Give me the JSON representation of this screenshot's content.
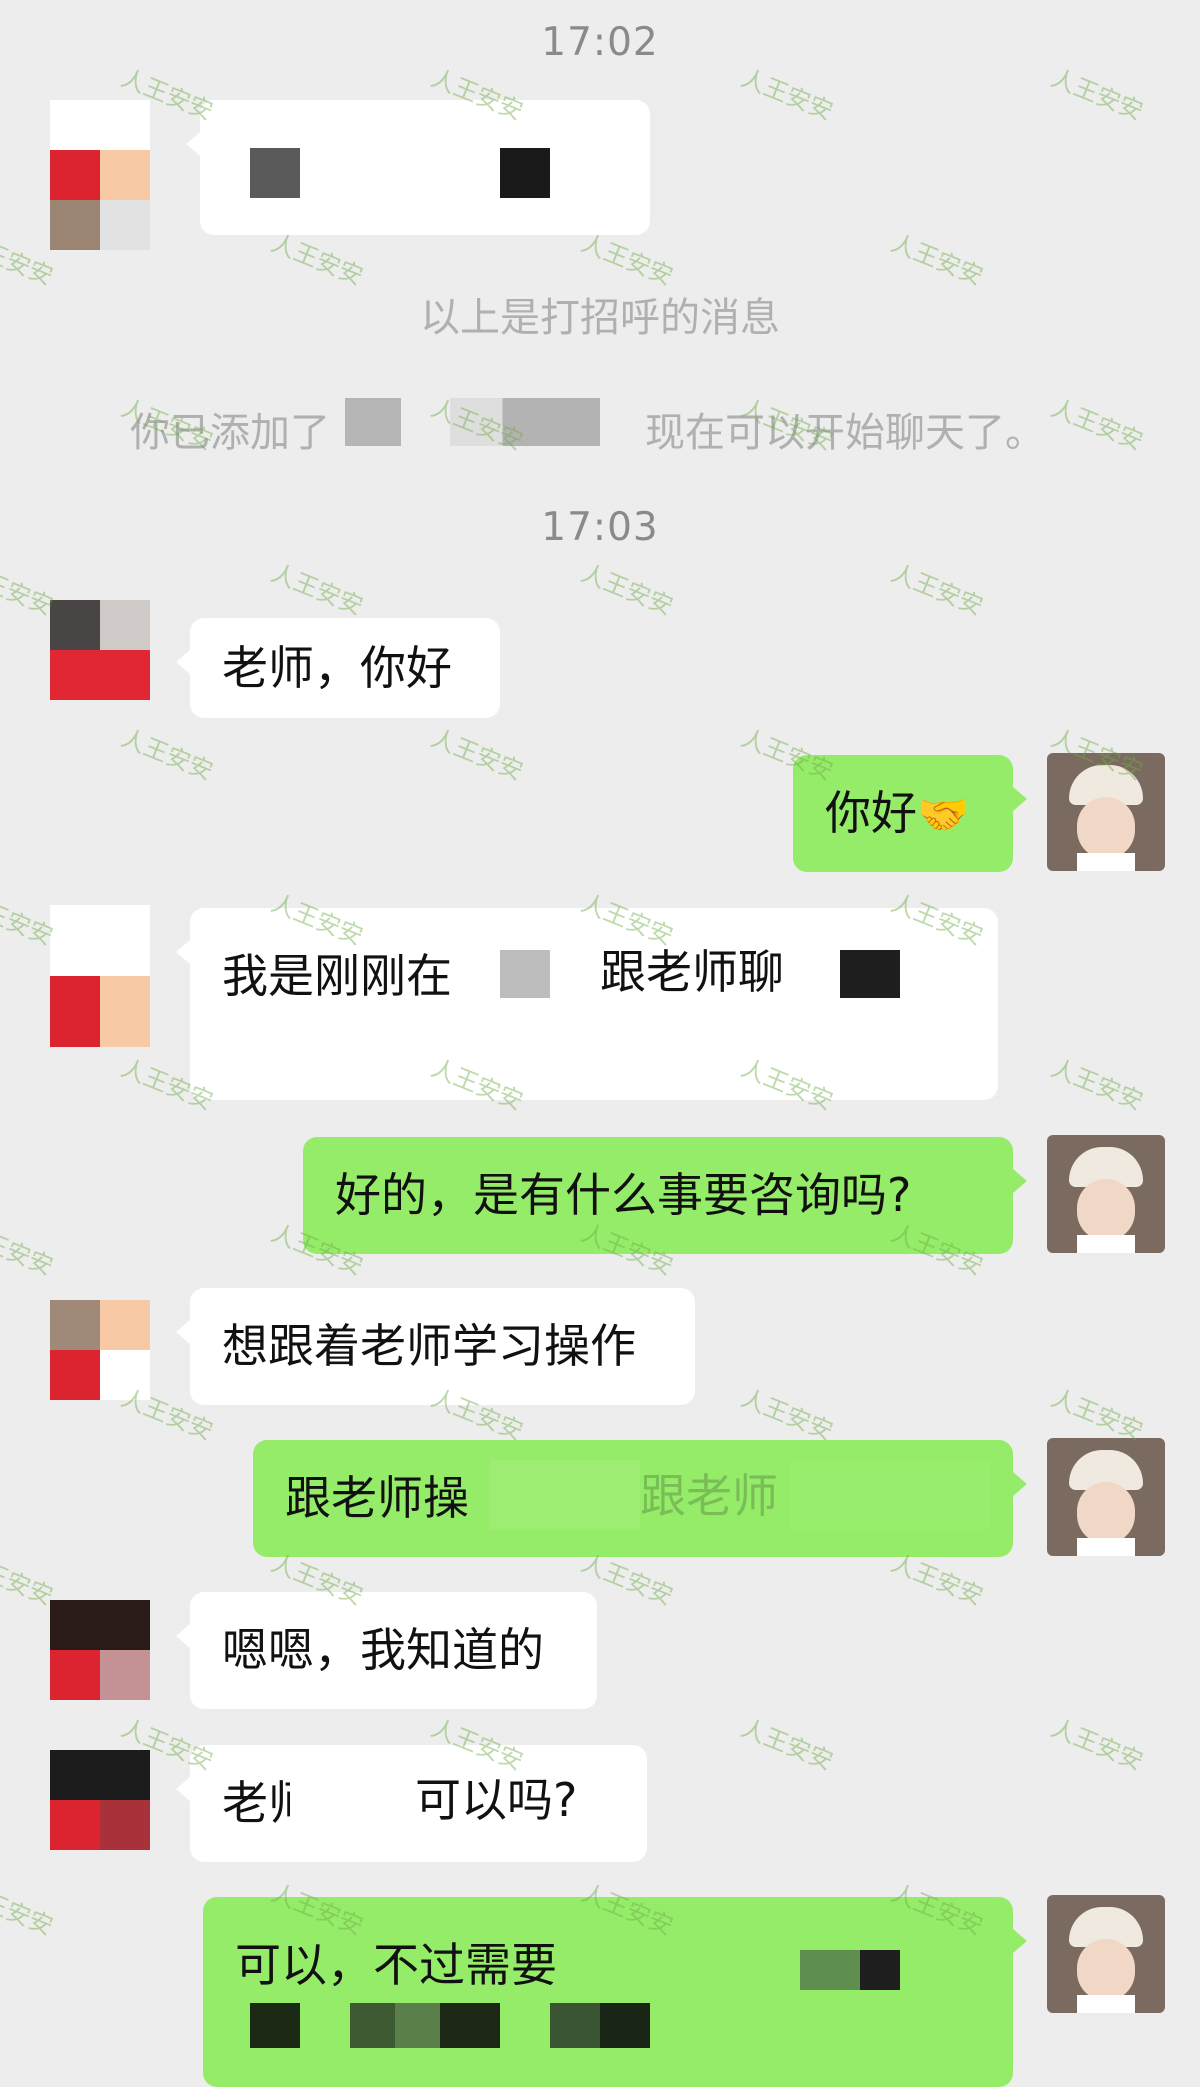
{
  "timestamps": [
    "17:02",
    "17:03"
  ],
  "system_messages": {
    "greeting_note": "以上是打招呼的消息",
    "added_note_prefix": "你已添加了",
    "added_note_suffix": "现在可以开始聊天了。"
  },
  "messages": [
    {
      "from": "contact",
      "text": ""
    },
    {
      "from": "contact",
      "text": "老师，你好"
    },
    {
      "from": "me",
      "text": "你好"
    },
    {
      "from": "contact",
      "text": "我是刚刚在",
      "text_b": "跟老师聊"
    },
    {
      "from": "me",
      "text": "好的，是有什么事要咨询吗?"
    },
    {
      "from": "contact",
      "text": "想跟着老师学习操作"
    },
    {
      "from": "me",
      "text": "跟老师操",
      "text_b": "跟老师"
    },
    {
      "from": "contact",
      "text": "嗯嗯，我知道的"
    },
    {
      "from": "contact",
      "text": "老师",
      "text_b": "可以吗?"
    },
    {
      "from": "me",
      "text": "可以，不过需要"
    }
  ],
  "emoji": {
    "handshake": "🤝"
  },
  "watermark": "人王安安",
  "colors": {
    "background": "#ededed",
    "incoming_bubble": "#ffffff",
    "outgoing_bubble": "#95ec69",
    "timestamp": "#8a8a8a"
  }
}
